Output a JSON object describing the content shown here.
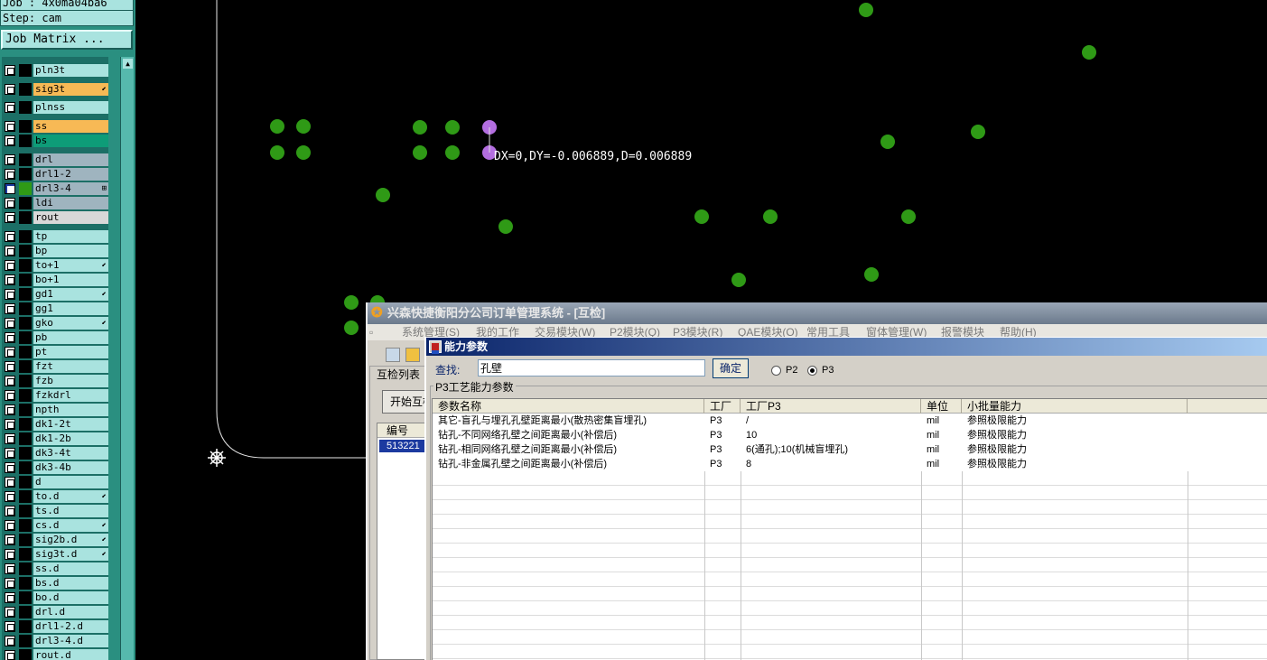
{
  "left_panel": {
    "job_line": "Job : 4x0ma04ba6",
    "step_line": "Step: cam",
    "job_matrix_label": "Job Matrix ...",
    "layers": [
      {
        "name": "pln3t",
        "mark": ""
      },
      {
        "name": "sig3t",
        "mark": "⬋",
        "color": "#f7b955"
      },
      {
        "name": "plnss",
        "mark": ""
      },
      {
        "name": "ss",
        "mark": "",
        "color": "#f7b955"
      },
      {
        "name": "bs",
        "mark": "",
        "color": "#0e9c78"
      },
      {
        "name": "drl",
        "mark": ""
      },
      {
        "name": "drl1-2",
        "mark": ""
      },
      {
        "name": "drl3-4",
        "mark": "⊞",
        "selected": true
      },
      {
        "name": "ldi",
        "mark": ""
      },
      {
        "name": "rout",
        "mark": ""
      },
      {
        "name": "tp",
        "mark": ""
      },
      {
        "name": "bp",
        "mark": ""
      },
      {
        "name": "to+1",
        "mark": "⬋"
      },
      {
        "name": "bo+1",
        "mark": ""
      },
      {
        "name": "gd1",
        "mark": "⬋"
      },
      {
        "name": "gg1",
        "mark": ""
      },
      {
        "name": "gko",
        "mark": "⬋"
      },
      {
        "name": "pb",
        "mark": ""
      },
      {
        "name": "pt",
        "mark": ""
      },
      {
        "name": "fzt",
        "mark": ""
      },
      {
        "name": "fzb",
        "mark": ""
      },
      {
        "name": "fzkdrl",
        "mark": ""
      },
      {
        "name": "npth",
        "mark": ""
      },
      {
        "name": "dk1-2t",
        "mark": ""
      },
      {
        "name": "dk1-2b",
        "mark": ""
      },
      {
        "name": "dk3-4t",
        "mark": ""
      },
      {
        "name": "dk3-4b",
        "mark": ""
      },
      {
        "name": "d",
        "mark": ""
      },
      {
        "name": "to.d",
        "mark": "⬋"
      },
      {
        "name": "ts.d",
        "mark": ""
      },
      {
        "name": "cs.d",
        "mark": "⬋"
      },
      {
        "name": "sig2b.d",
        "mark": "⬋"
      },
      {
        "name": "sig3t.d",
        "mark": "⬋"
      },
      {
        "name": "ss.d",
        "mark": ""
      },
      {
        "name": "bs.d",
        "mark": ""
      },
      {
        "name": "bo.d",
        "mark": ""
      },
      {
        "name": "drl.d",
        "mark": ""
      },
      {
        "name": "drl1-2.d",
        "mark": ""
      },
      {
        "name": "drl3-4.d",
        "mark": ""
      },
      {
        "name": "rout.d",
        "mark": ""
      }
    ]
  },
  "canvas": {
    "measure_readout": "DX=0,DY=-0.006889,D=0.006889",
    "pad_color": "#2f9a16",
    "highlight_color": "#b36ee0"
  },
  "app_window": {
    "title": "兴森快捷衡阳分公司订单管理系统 - [互检]",
    "menu": [
      "系统管理(S)",
      "我的工作",
      "交易模块(W)",
      "P2模块(Q)",
      "P3模块(R)",
      "QAE模块(O)",
      "常用工具",
      "窗体管理(W)",
      "报警模块",
      "帮助(H)"
    ],
    "list_group_label": "互检列表",
    "start_button": "开始互检",
    "id_header": "编号",
    "id_value": "513221"
  },
  "dialog": {
    "title": "能力参数",
    "search_label": "查找:",
    "search_value": "孔壁",
    "confirm_label": "确定",
    "radio_p2": "P2",
    "radio_p3": "P3",
    "selected_radio": "P3",
    "group_title": "P3工艺能力参数",
    "columns": [
      "参数名称",
      "工厂",
      "工厂P3",
      "单位",
      "小批量能力"
    ],
    "rows": [
      [
        "其它-盲孔与埋孔孔壁距离最小(散热密集盲埋孔)",
        "P3",
        "/",
        "mil",
        "参照极限能力"
      ],
      [
        "钻孔-不同网络孔壁之间距离最小(补偿后)",
        "P3",
        "10",
        "mil",
        "参照极限能力"
      ],
      [
        "钻孔-相同网络孔壁之间距离最小(补偿后)",
        "P3",
        "6(通孔);10(机械盲埋孔)",
        "mil",
        "参照极限能力"
      ],
      [
        "钻孔-非金属孔壁之间距离最小(补偿后)",
        "P3",
        "8",
        "mil",
        "参照极限能力"
      ]
    ]
  }
}
